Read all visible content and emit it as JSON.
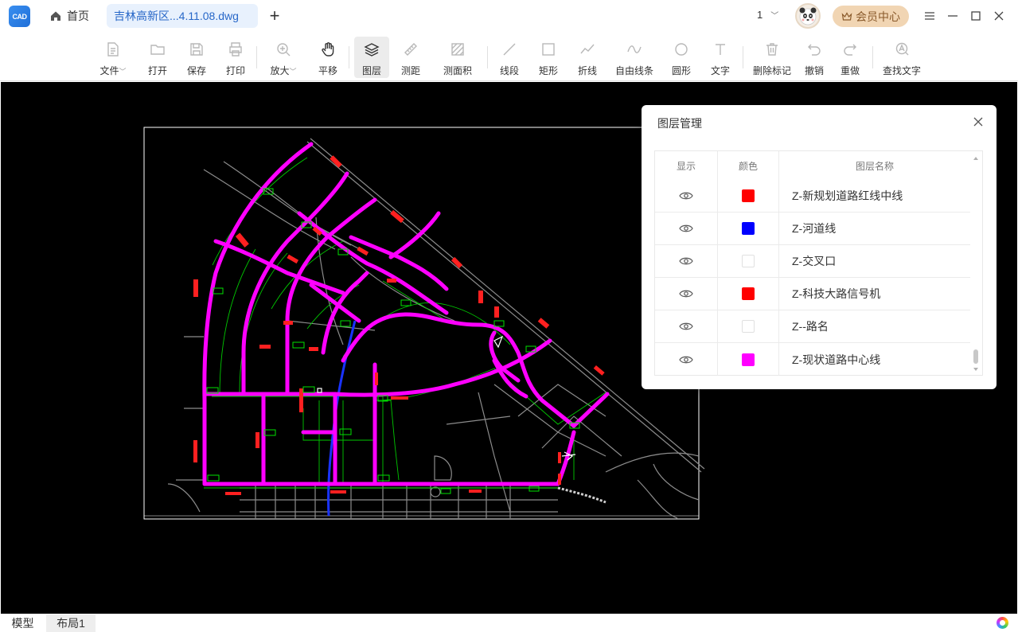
{
  "titlebar": {
    "logo_text": "CAD",
    "home_label": "首页",
    "file_tab": "吉林高新区...4.11.08.dwg",
    "add_tab": "+",
    "page_number": "1",
    "member_label": "会员中心"
  },
  "toolbar": {
    "tools": [
      {
        "label": "文件",
        "icon": "file-icon"
      },
      {
        "label": "打开",
        "icon": "folder-icon"
      },
      {
        "label": "保存",
        "icon": "save-icon"
      },
      {
        "label": "打印",
        "icon": "print-icon"
      },
      {
        "label": "放大",
        "icon": "zoom-in-icon"
      },
      {
        "label": "平移",
        "icon": "hand-icon"
      },
      {
        "label": "图层",
        "icon": "layers-icon"
      },
      {
        "label": "测距",
        "icon": "ruler-icon"
      },
      {
        "label": "测面积",
        "icon": "area-icon"
      },
      {
        "label": "线段",
        "icon": "line-icon"
      },
      {
        "label": "矩形",
        "icon": "rectangle-icon"
      },
      {
        "label": "折线",
        "icon": "polyline-icon"
      },
      {
        "label": "自由线条",
        "icon": "freehand-icon"
      },
      {
        "label": "圆形",
        "icon": "circle-icon"
      },
      {
        "label": "文字",
        "icon": "text-icon"
      },
      {
        "label": "删除标记",
        "icon": "trash-icon"
      },
      {
        "label": "撤销",
        "icon": "undo-icon"
      },
      {
        "label": "重做",
        "icon": "redo-icon"
      },
      {
        "label": "查找文字",
        "icon": "find-text-icon"
      }
    ],
    "active_tool": "图层"
  },
  "layer_panel": {
    "title": "图层管理",
    "headers": {
      "show": "显示",
      "color": "颜色",
      "name": "图层名称"
    },
    "layers": [
      {
        "name": "Z-新规划道路红线中线",
        "color": "#ff0000",
        "visible": true
      },
      {
        "name": "Z-河道线",
        "color": "#0000ff",
        "visible": true
      },
      {
        "name": "Z-交叉口",
        "color": "#ffffff",
        "visible": true
      },
      {
        "name": "Z-科技大路信号机",
        "color": "#ff0000",
        "visible": true
      },
      {
        "name": "Z--路名",
        "color": "#ffffff",
        "visible": true
      },
      {
        "name": "Z-现状道路中心线",
        "color": "#ff00ff",
        "visible": true
      }
    ]
  },
  "bottom_tabs": {
    "model": "模型",
    "layout": "布局1"
  }
}
